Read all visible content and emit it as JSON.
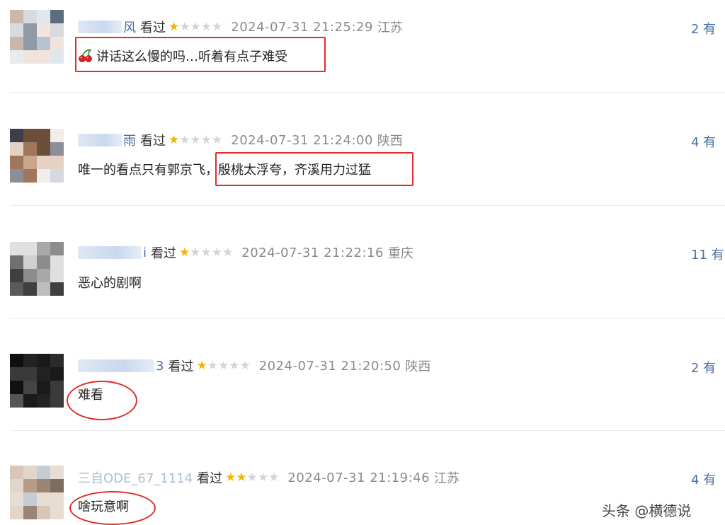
{
  "reviews": [
    {
      "username_tail": "风",
      "watched": "看过",
      "rating": 1,
      "time": "2024-07-31 21:25:29",
      "location": "江苏",
      "useful": "2 有",
      "comment": "讲话这么慢的吗…听着有点子难受",
      "emoji": "cherry-icon"
    },
    {
      "username_tail": "雨",
      "watched": "看过",
      "rating": 1,
      "time": "2024-07-31 21:24:00",
      "location": "陕西",
      "useful": "4 有",
      "comment_a": "唯一的看点只有郭京飞，",
      "comment_b": "殷桃太浮夸，齐溪用力过猛"
    },
    {
      "username_tail": "i",
      "watched": "看过",
      "rating": 1,
      "time": "2024-07-31 21:22:16",
      "location": "重庆",
      "useful": "11 有",
      "comment": "恶心的剧啊"
    },
    {
      "username_tail": "3",
      "watched": "看过",
      "rating": 1,
      "time": "2024-07-31 21:20:50",
      "location": "陕西",
      "useful": "2 有",
      "comment": "难看"
    },
    {
      "username_tail": "三自ODE_67_1114",
      "watched": "看过",
      "rating": 2,
      "time": "2024-07-31 21:19:46",
      "location": "江苏",
      "useful": "4 有",
      "comment": "啥玩意啊"
    }
  ],
  "watermark": "头条 @横德说",
  "colors": {
    "highlight": "#e02b2b",
    "star": "#f4b400",
    "link": "#4a6fa0"
  }
}
